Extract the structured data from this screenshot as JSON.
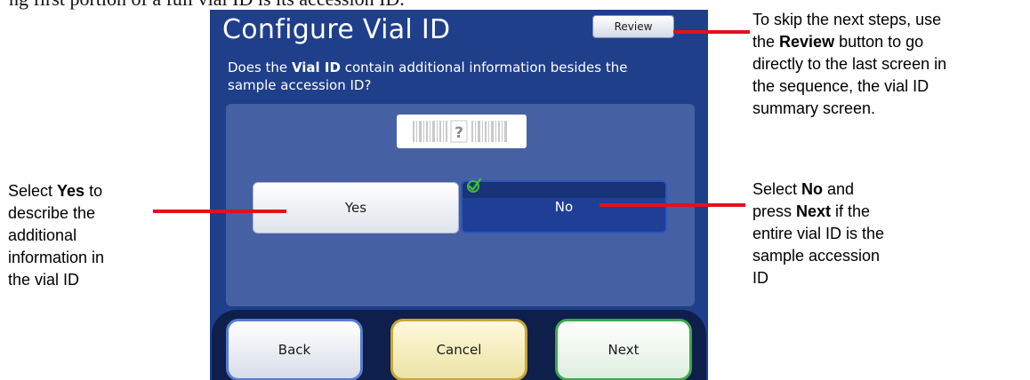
{
  "page_fragment": "ng first portion of a full vial ID is its accession ID.",
  "screen": {
    "title": "Configure Vial ID",
    "review_label": "Review",
    "question": {
      "part1": "Does the ",
      "bold": "Vial ID",
      "part2": " contain additional information besides the sample accession ID?"
    },
    "barcode_symbol": "?",
    "yes_label": "Yes",
    "no_label": "No",
    "no_selected": true,
    "nav": {
      "back": "Back",
      "cancel": "Cancel",
      "next": "Next"
    }
  },
  "annotations": {
    "review": {
      "l1": "To skip the next steps, use",
      "l2a": "the ",
      "l2b": "Review",
      "l2c": " button to go",
      "l3": "directly to the last screen in",
      "l4": "the sequence, the vial ID",
      "l5": "summary screen."
    },
    "yes": {
      "l1a": "Select ",
      "l1b": "Yes",
      "l1c": " to",
      "l2": "describe the",
      "l3": "additional",
      "l4": "information in",
      "l5": "the vial ID"
    },
    "no": {
      "l1a": "Select ",
      "l1b": "No",
      "l1c": " and",
      "l2a": "press ",
      "l2b": "Next",
      "l2c": " if the",
      "l3": "entire vial ID is the",
      "l4": "sample accession",
      "l5": "ID"
    }
  },
  "colors": {
    "screen_bg": "#1f3f8b",
    "panel": "#4660a4",
    "selected": "#1e3f95",
    "annotation_line": "#e3101e",
    "check": "#3dbb3a"
  }
}
